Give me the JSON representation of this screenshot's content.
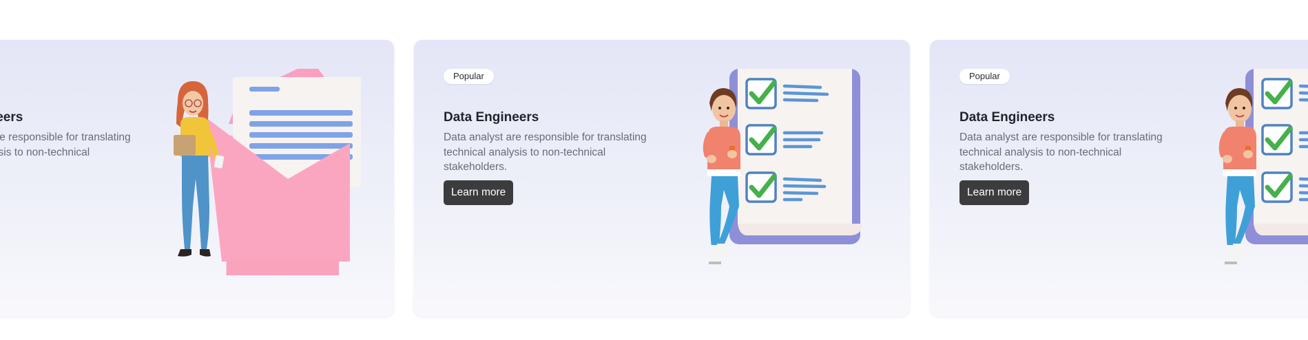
{
  "cards": [
    {
      "title": "Data Engineers",
      "description": "Data analyst are responsible for translating technical analysis to non-technical stakeholders.",
      "illustration": "woman-with-envelope-illustration"
    },
    {
      "badge": "Popular",
      "title": "Data Engineers",
      "description": "Data analyst are responsible for translating technical analysis to non-technical stakeholders.",
      "button_label": "Learn more",
      "illustration": "woman-with-checklist-illustration"
    },
    {
      "badge": "Popular",
      "title": "Data Engineers",
      "description": "Data analyst are responsible for translating technical analysis to non-technical stakeholders.",
      "button_label": "Learn more",
      "illustration": "woman-with-checklist-illustration"
    }
  ],
  "colors": {
    "card_background": "#e4e6f7",
    "button": "#3c3c3e",
    "envelope": "#f9a3bd",
    "checklist_frame": "#8f8fd8",
    "check": "#4caf50",
    "line_accent": "#5c95d6"
  }
}
